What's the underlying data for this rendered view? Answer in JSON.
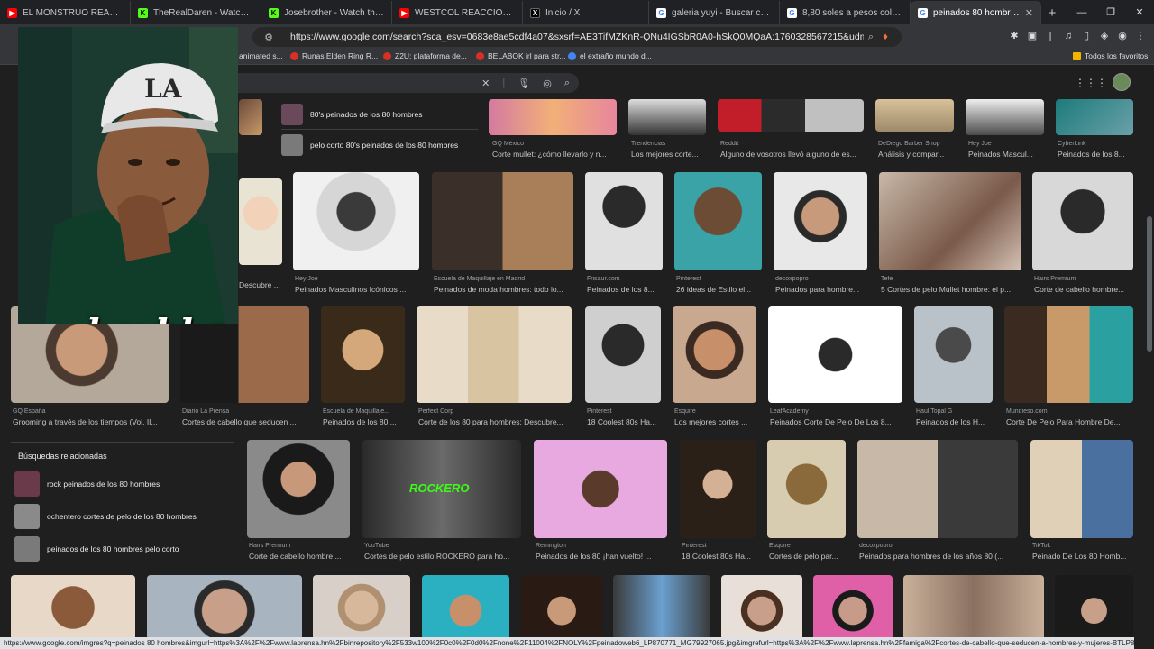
{
  "tabs": [
    {
      "label": "EL MONSTRUO REAL QUE INSP",
      "icon": "youtube-icon",
      "color": "#ff0000"
    },
    {
      "label": "TheRealDaren - Watch the VOD",
      "icon": "kick-icon",
      "color": "#53fc18"
    },
    {
      "label": "Josebrother - Watch the VOD",
      "icon": "kick-icon",
      "color": "#53fc18"
    },
    {
      "label": "WESTCOL REACCIONA A SU D",
      "icon": "youtube-icon",
      "color": "#ff0000"
    },
    {
      "label": "Inicio / X",
      "icon": "x-icon",
      "color": "#000000"
    },
    {
      "label": "galeria yuyi - Buscar con Goog",
      "icon": "google-icon",
      "color": "#ffffff"
    },
    {
      "label": "8,80 soles a pesos colombiano",
      "icon": "google-icon",
      "color": "#ffffff"
    },
    {
      "label": "peinados 80 hombres - Bus",
      "icon": "google-icon",
      "color": "#ffffff",
      "active": true
    }
  ],
  "address": {
    "url": "https://www.google.com/search?sca_esv=0683e8ae5cdf4a07&sxsrf=AE3TifMZKnR-QNu4IGSbR0A0-hSkQ0MQaA:1760328567215&udm=2&fbs=AIIjpHx4..."
  },
  "bookmarks": [
    {
      "label": "animated s..."
    },
    {
      "label": "Runas Elden Ring R..."
    },
    {
      "label": "Z2U: plataforma de..."
    },
    {
      "label": "BELABOK irl para str..."
    },
    {
      "label": "el extraño mundo d..."
    }
  ],
  "bookmarks_folder": "Todos los favoritos",
  "related_top": [
    {
      "label": "80's peinados de los 80 hombres"
    },
    {
      "label": "pelo corto 80's peinados de los 80 hombres"
    }
  ],
  "related": {
    "heading": "Búsquedas relacionadas",
    "items": [
      {
        "label": "rock peinados de los 80 hombres"
      },
      {
        "label": "ochentero cortes de pelo de los 80 hombres"
      },
      {
        "label": "peinados de los 80 hombres pelo corto"
      }
    ]
  },
  "row1": [
    {
      "src": "GQ México",
      "title": "Corte mullet: ¿cómo llevarlo y n..."
    },
    {
      "src": "Trendencias",
      "title": "Los mejores corte..."
    },
    {
      "src": "Reddit",
      "title": "Alguno de vosotros llevó alguno de es..."
    },
    {
      "src": "DeDiego Barber Shop",
      "title": "Análisis y compar..."
    },
    {
      "src": "Hey Joe",
      "title": "Peinados Mascul..."
    },
    {
      "src": "CyberLink",
      "title": "Peinados de los 8..."
    }
  ],
  "row2": [
    {
      "src": "",
      "title": "Descubre ..."
    },
    {
      "src": "Hey Joe",
      "title": "Peinados Masculinos Icónicos ..."
    },
    {
      "src": "Escuela de Maquillaje en Madrid",
      "title": "Peinados de moda hombres: todo lo..."
    },
    {
      "src": "Frisaur.com",
      "title": "Peinados de los 8..."
    },
    {
      "src": "Pinterest",
      "title": "26 ideas de Estilo el..."
    },
    {
      "src": "decoxpopro",
      "title": "Peinados para hombre..."
    },
    {
      "src": "Tefe",
      "title": "5 Cortes de pelo Mullet hombre: el p..."
    },
    {
      "src": "Hairs Premium",
      "title": "Corte de cabello hombre..."
    }
  ],
  "row3": [
    {
      "src": "GQ España",
      "title": "Grooming a través de los tiempos (Vol. II..."
    },
    {
      "src": "Diario La Prensa",
      "title": "Cortes de cabello que seducen ..."
    },
    {
      "src": "Escuela de Maquillaje...",
      "title": "Peinados de los 80 ..."
    },
    {
      "src": "Perfect Corp",
      "title": "Corte de los 80 para hombres: Descubre..."
    },
    {
      "src": "Pinterest",
      "title": "18 Coolest 80s Ha..."
    },
    {
      "src": "Esquire",
      "title": "Los mejores cortes ..."
    },
    {
      "src": "LeafAcademy",
      "title": "Peinados Corte De Pelo De Los 8..."
    },
    {
      "src": "Haul Topal G",
      "title": "Peinados de los H..."
    },
    {
      "src": "Mundieso.com",
      "title": "Corte De Pelo Para Hombre De..."
    }
  ],
  "row3_labels": {
    "rockero": "ROCKERO"
  },
  "row4": [
    {
      "src": "Hairs Premium",
      "title": "Corte de cabello hombre ..."
    },
    {
      "src": "YouTube",
      "title": "Cortes de pelo estilo ROCKERO para ho..."
    },
    {
      "src": "Remington",
      "title": "Peinados de los 80 ¡han vuelto! ..."
    },
    {
      "src": "Pinterest",
      "title": "18 Coolest 80s Ha..."
    },
    {
      "src": "Esquire",
      "title": "Cortes de pelo par..."
    },
    {
      "src": "decoxpopro",
      "title": "Peinados para hombres de los años 80 (..."
    },
    {
      "src": "TikTok",
      "title": "Peinado De Los 80 Homb..."
    }
  ],
  "streamer": {
    "name": "kaykka"
  },
  "status_url": "https://www.google.com/imgres?q=peinados 80 hombres&imgurl=https%3A%2F%2Fwww.laprensa.hn%2Fbinrepository%2F533w100%2F0c0%2F0d0%2Fnone%2F11004%2FNOLY%2Fpeinadoweb6_LP870771_MG79927065.jpg&imgrefurl=https%3A%2F%2Fwww.laprensa.hn%2Ffamiga%2Fcortes-de-cabello-que-seducen-a-hombres-y-mujeres-BTLP870771..."
}
